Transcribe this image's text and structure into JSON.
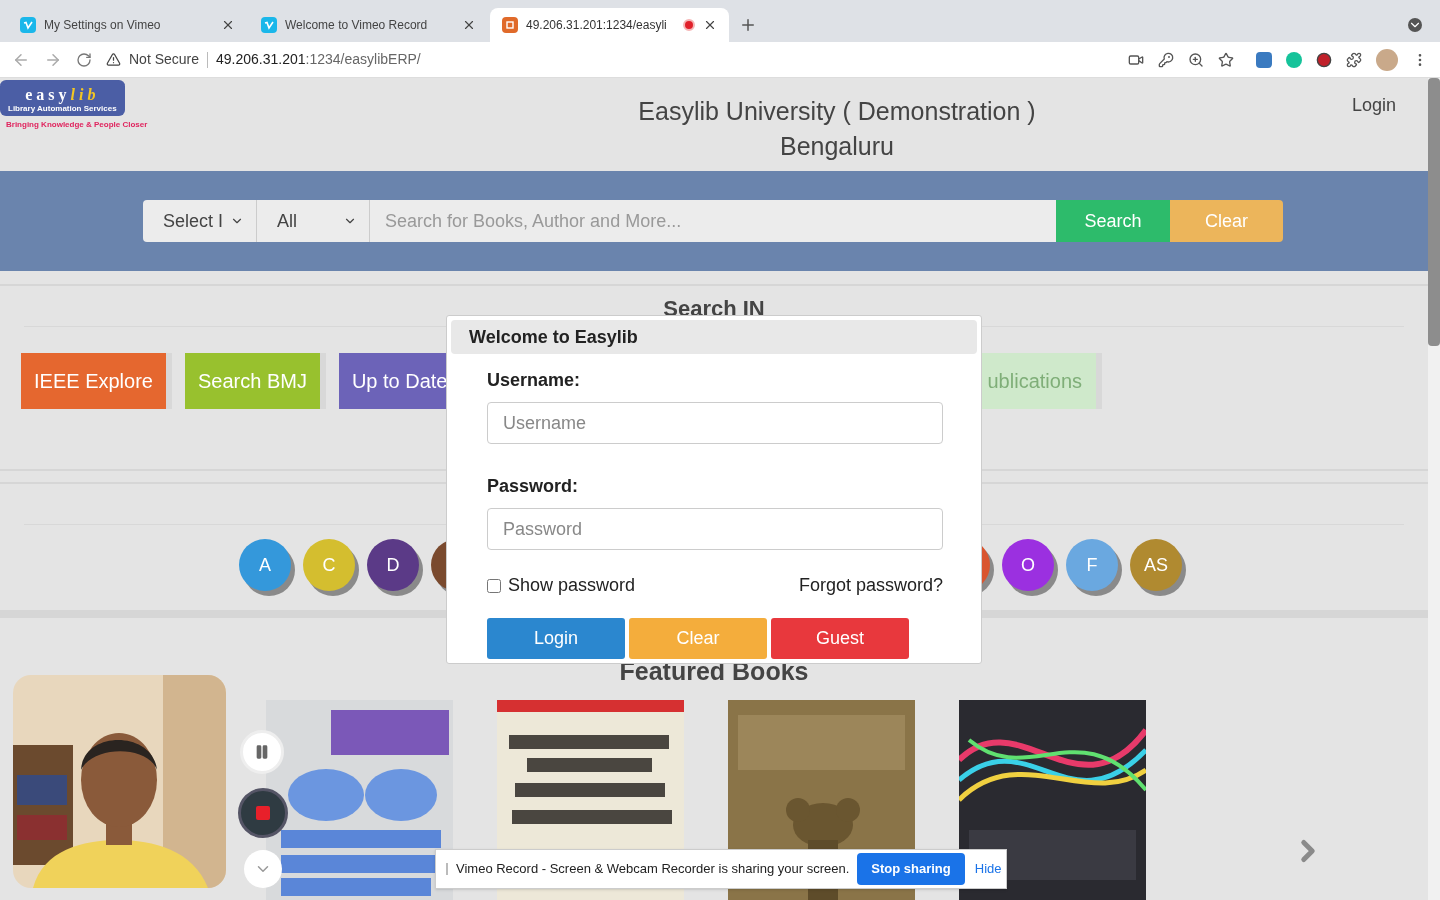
{
  "browser": {
    "tabs": [
      {
        "title": "My Settings on Vimeo",
        "kind": "vimeo",
        "selected": false,
        "recording": false
      },
      {
        "title": "Welcome to Vimeo Record",
        "kind": "vimeo",
        "selected": false,
        "recording": false
      },
      {
        "title": "49.206.31.201:1234/easyli",
        "kind": "site",
        "selected": true,
        "recording": true
      }
    ],
    "security": "Not Secure",
    "url_host": "49.206.31.201",
    "url_rest": ":1234/easylibERP/"
  },
  "header": {
    "logo_word": "easy",
    "logo_word_accent": "lib",
    "logo_sub": "Library Automation Services",
    "logo_tagline": "Bringing Knowledge & People Closer",
    "title": "Easylib University ( Demonstration )",
    "subtitle": "Bengaluru",
    "login": "Login"
  },
  "search": {
    "type_select": "Select I",
    "scope_select": "All",
    "placeholder": "Search for Books, Author and More...",
    "search_button": "Search",
    "clear_button": "Clear"
  },
  "search_in": {
    "heading": "Search IN",
    "resources": [
      {
        "label": "IEEE Explore",
        "color": "#e5672f",
        "faded": false
      },
      {
        "label": "Search BMJ",
        "color": "#98c12e",
        "faded": false
      },
      {
        "label": "Up to Date",
        "color": "#6c63b8",
        "faded": false
      },
      {
        "label": "ublications",
        "color": "#cfe9cb",
        "faded": true
      }
    ]
  },
  "authors": {
    "left": [
      {
        "letter": "A",
        "color": "#3498db"
      },
      {
        "letter": "C",
        "color": "#d4be2f"
      },
      {
        "letter": "D",
        "color": "#5b3a87"
      },
      {
        "color": "#7a4a2e"
      }
    ],
    "right": [
      {
        "color": "#d9552f"
      },
      {
        "letter": "O",
        "color": "#9b30e0"
      },
      {
        "letter": "F",
        "color": "#6aa8e0"
      },
      {
        "letter": "AS",
        "color": "#b08a30"
      }
    ]
  },
  "featured": {
    "heading": "Featured Books"
  },
  "login_dialog": {
    "title": "Welcome to Easylib",
    "username_label": "Username:",
    "username_placeholder": "Username",
    "password_label": "Password:",
    "password_placeholder": "Password",
    "show_password": {
      "label": "Show password",
      "checked": false
    },
    "forgot": "Forgot password?",
    "buttons": [
      {
        "label": "Login",
        "kind": "primary"
      },
      {
        "label": "Clear",
        "kind": "warning"
      },
      {
        "label": "Guest",
        "kind": "danger"
      }
    ]
  },
  "recorder": {
    "share_notice": "Vimeo Record - Screen & Webcam Recorder is sharing your screen.",
    "stop_button": "Stop sharing",
    "hide_link": "Hide"
  }
}
